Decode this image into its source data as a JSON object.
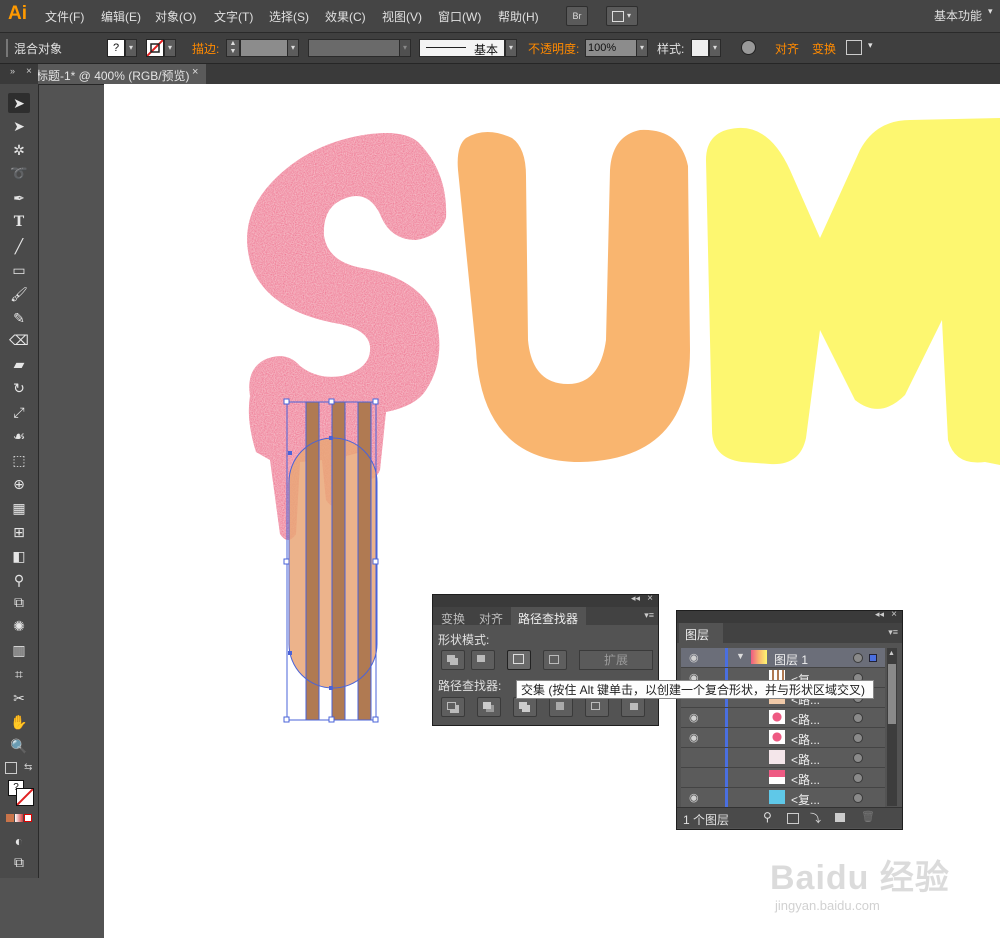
{
  "app": {
    "logo": "Ai",
    "workspace": "基本功能"
  },
  "menu": [
    "文件(F)",
    "编辑(E)",
    "对象(O)",
    "文字(T)",
    "选择(S)",
    "效果(C)",
    "视图(V)",
    "窗口(W)",
    "帮助(H)"
  ],
  "toolbar_icons": {
    "bridge": "Br",
    "arrange": "arrange-documents-icon"
  },
  "control": {
    "object_type": "混合对象",
    "fill_label": "?",
    "stroke_label": "描边:",
    "brush_label": "基本",
    "opacity_label": "不透明度:",
    "opacity_value": "100%",
    "style_label": "样式:",
    "align_label": "对齐",
    "transform_label": "变换"
  },
  "document_tab": {
    "title": "未标题-1* @ 400% (RGB/预览)"
  },
  "artwork": {
    "letters": [
      "S",
      "U",
      "M"
    ],
    "colors": {
      "s": "#ee5a83",
      "u": "#f9b56f",
      "m": "#fdf770",
      "stripe": "#b07a52",
      "selection": "#4a63d8"
    }
  },
  "pathfinder": {
    "tabs": [
      "变换",
      "对齐",
      "路径查找器"
    ],
    "shape_modes_label": "形状模式:",
    "expand_label": "扩展",
    "pathfinders_label": "路径查找器:",
    "tooltip": "交集 (按住 Alt 键单击，以创建一个复合形状，并与形状区域交叉)"
  },
  "layers": {
    "tab": "图层",
    "rows": [
      {
        "name": "图层 1",
        "level": 0
      },
      {
        "name": "<复...",
        "level": 1
      },
      {
        "name": "<路...",
        "level": 1
      },
      {
        "name": "<路...",
        "level": 1
      },
      {
        "name": "<路...",
        "level": 1
      },
      {
        "name": "<路...",
        "level": 1
      },
      {
        "name": "<路...",
        "level": 1
      },
      {
        "name": "<复...",
        "level": 1
      }
    ],
    "footer": "1 个图层"
  },
  "watermark": {
    "brand": "Baidu 经验",
    "url": "jingyan.baidu.com"
  }
}
